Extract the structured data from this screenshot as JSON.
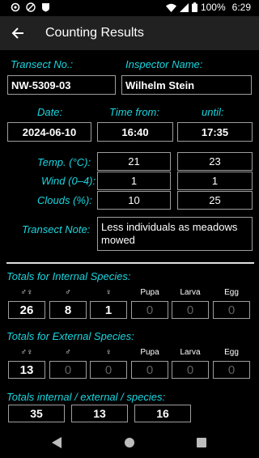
{
  "status": {
    "battery": "100%",
    "time": "6:29"
  },
  "appbar": {
    "title": "Counting Results"
  },
  "transect": {
    "number_label": "Transect No.:",
    "number": "NW-5309-03",
    "inspector_label": "Inspector Name:",
    "inspector": "Wilhelm Stein",
    "date_label": "Date:",
    "date": "2024-06-10",
    "time_from_label": "Time from:",
    "time_from": "16:40",
    "until_label": "until:",
    "until": "17:35",
    "temp_label": "Temp. (°C):",
    "temp_start": "21",
    "temp_end": "23",
    "wind_label": "Wind (0–4):",
    "wind_start": "1",
    "wind_end": "1",
    "clouds_label": "Clouds (%):",
    "clouds_start": "10",
    "clouds_end": "25",
    "note_label": "Transect Note:",
    "note": "Less individuals as meadows mowed"
  },
  "columns": [
    "♂♀",
    "♂",
    "♀",
    "Pupa",
    "Larva",
    "Egg"
  ],
  "internal": {
    "title": "Totals for Internal Species:",
    "values": [
      "26",
      "8",
      "1",
      "0",
      "0",
      "0"
    ]
  },
  "external": {
    "title": "Totals for External Species:",
    "values": [
      "13",
      "0",
      "0",
      "0",
      "0",
      "0"
    ]
  },
  "totals": {
    "title": "Totals internal / external / species:",
    "internal": "35",
    "external": "13",
    "species": "16"
  },
  "colors": {
    "accent": "#1ad6e0",
    "appbar": "#212121",
    "background": "#000000"
  }
}
